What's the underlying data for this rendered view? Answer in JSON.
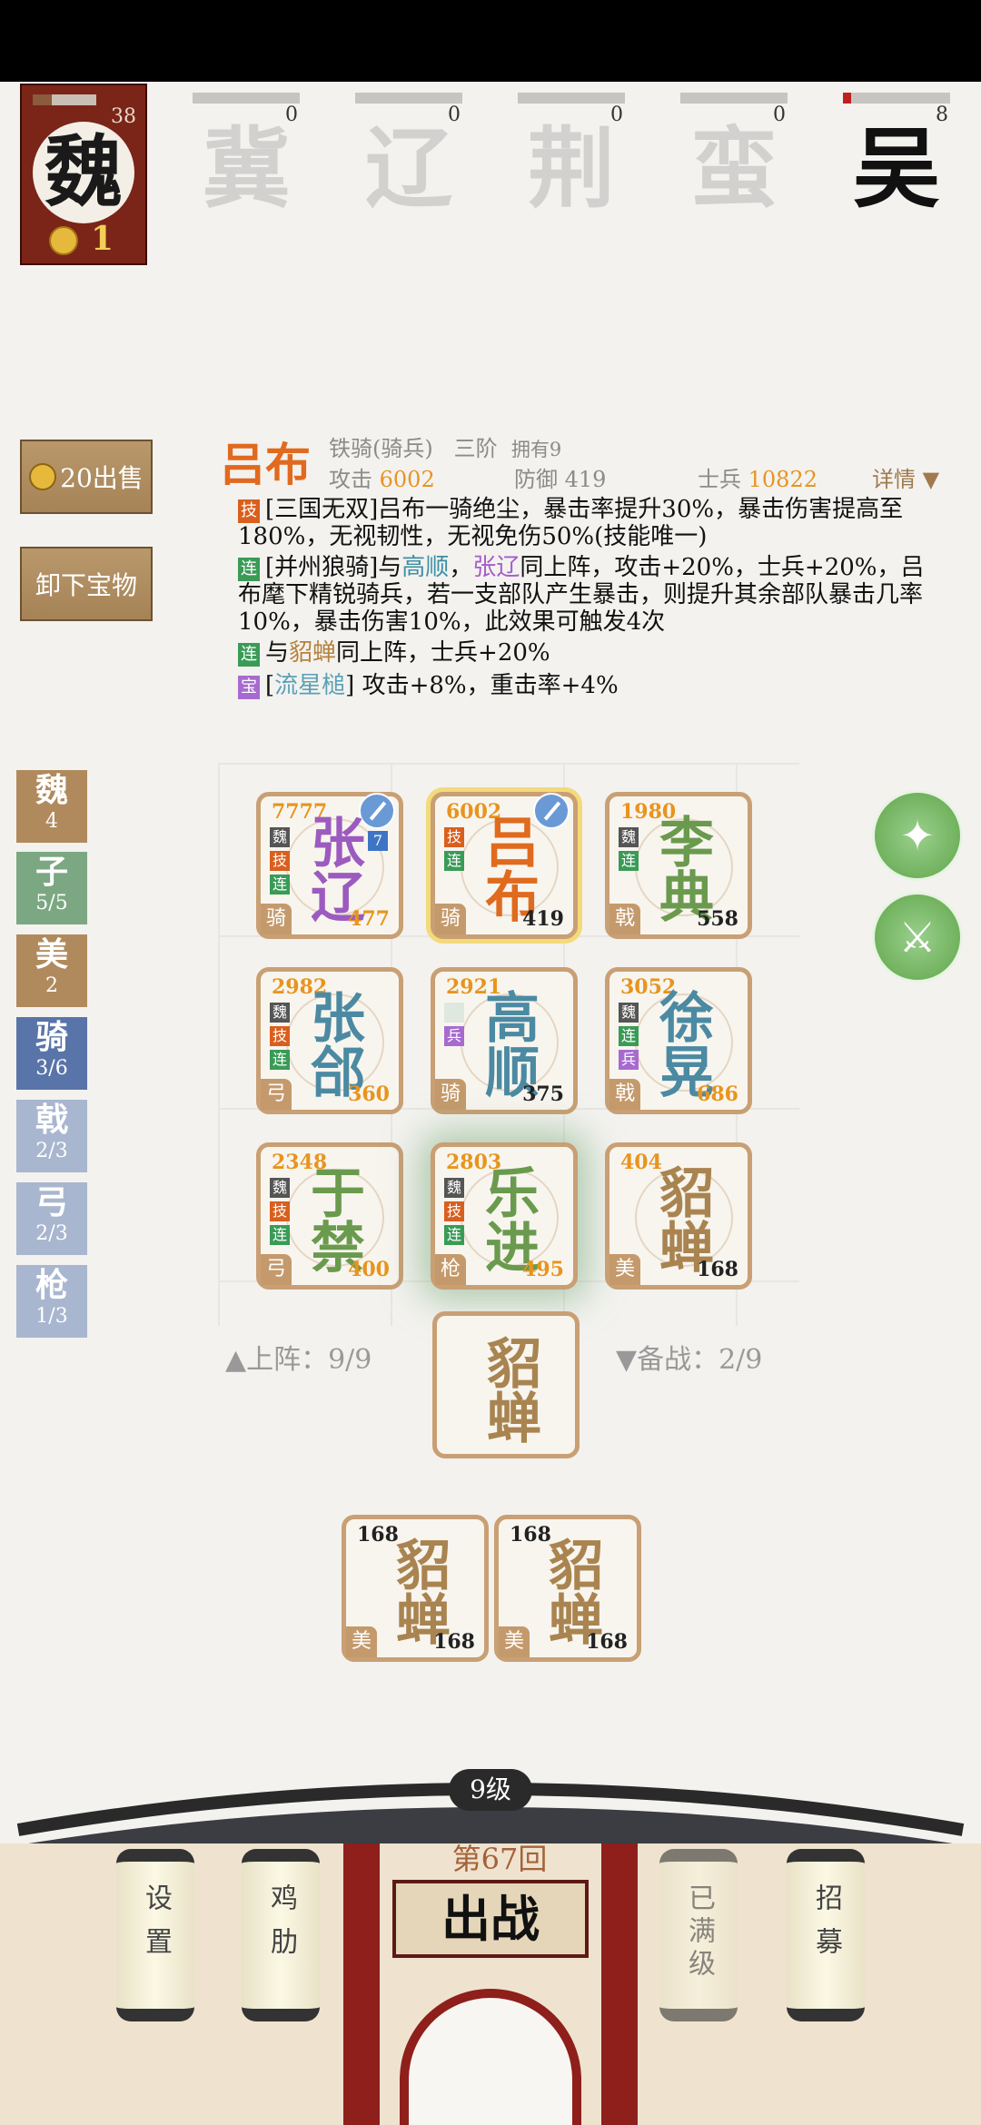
{
  "header": {
    "my_kingdom": {
      "name": "魏",
      "count": "38",
      "coins": "1",
      "bar_fill": 0.3
    },
    "states": [
      {
        "name": "冀",
        "count": "0",
        "bar_fill": 0
      },
      {
        "name": "辽",
        "count": "0",
        "bar_fill": 0
      },
      {
        "name": "荆",
        "count": "0",
        "bar_fill": 0
      },
      {
        "name": "蛮",
        "count": "0",
        "bar_fill": 0
      },
      {
        "name": "吴",
        "count": "8",
        "bar_fill": 0.08
      }
    ]
  },
  "buttons": {
    "sell": "20出售",
    "unequip": "卸下宝物",
    "details": "详情"
  },
  "hero": {
    "name": "吕布",
    "type": "铁骑(骑兵)",
    "rank": "三阶",
    "owned": "拥有9",
    "attack_label": "攻击",
    "attack": "6002",
    "defense_label": "防御",
    "defense": "419",
    "troops_label": "士兵",
    "troops": "10822"
  },
  "skills": [
    {
      "tag": "技",
      "text": "[三国无双]吕布一骑绝尘，暴击率提升30%，暴击伤害提高至180%，无视韧性，无视免伤50%(技能唯一)"
    },
    {
      "tag": "连",
      "pre": "[并州狼骑]与",
      "n1": "高顺",
      "sep": "，",
      "n2": "张辽",
      "post": "同上阵，攻击+20%，士兵+20%，吕布麾下精锐骑兵，若一支部队产生暴击，则提升其余部队暴击几率10%，暴击伤害10%，此效果可触发4次"
    },
    {
      "tag": "连",
      "pre": "与",
      "n1": "貂蝉",
      "post": "同上阵，士兵+20%"
    },
    {
      "tag": "宝",
      "pre": "[",
      "n1": "流星槌",
      "post": "] 攻击+8%，重击率+4%"
    }
  ],
  "filters": [
    {
      "label": "魏",
      "count": "4"
    },
    {
      "label": "子",
      "count": "5/5"
    },
    {
      "label": "美",
      "count": "2"
    },
    {
      "label": "骑",
      "count": "3/6"
    },
    {
      "label": "戟",
      "count": "2/3"
    },
    {
      "label": "弓",
      "count": "2/3"
    },
    {
      "label": "枪",
      "count": "1/3"
    }
  ],
  "grid_cards": [
    {
      "name1": "张",
      "name2": "辽",
      "atk": "7777",
      "hp": "477",
      "type": "骑",
      "tags": [
        "魏",
        "技",
        "连"
      ],
      "lvl": "7"
    },
    {
      "name1": "吕",
      "name2": "布",
      "atk": "6002",
      "hp": "419",
      "type": "骑",
      "tags": [
        "技",
        "连"
      ]
    },
    {
      "name1": "李",
      "name2": "典",
      "atk": "1980",
      "hp": "558",
      "type": "戟",
      "tags": [
        "魏",
        "连"
      ]
    },
    {
      "name1": "张",
      "name2": "郃",
      "atk": "2982",
      "hp": "360",
      "type": "弓",
      "tags": [
        "魏",
        "技",
        "连"
      ]
    },
    {
      "name1": "高",
      "name2": "顺",
      "atk": "2921",
      "hp": "375",
      "type": "骑",
      "tags": [
        "",
        "兵"
      ]
    },
    {
      "name1": "徐",
      "name2": "晃",
      "atk": "3052",
      "hp": "686",
      "type": "戟",
      "tags": [
        "魏",
        "连",
        "兵"
      ]
    },
    {
      "name1": "于",
      "name2": "禁",
      "atk": "2348",
      "hp": "400",
      "type": "弓",
      "tags": [
        "魏",
        "技",
        "连"
      ]
    },
    {
      "name1": "乐",
      "name2": "进",
      "atk": "2803",
      "hp": "495",
      "type": "枪",
      "tags": [
        "魏",
        "技",
        "连"
      ]
    },
    {
      "name1": "貂",
      "name2": "蝉",
      "atk": "404",
      "hp": "168",
      "type": "美",
      "tags": []
    }
  ],
  "deploy": {
    "on_label": "上阵：9/9",
    "reserve_label": "备战：2/9"
  },
  "center_card": {
    "name1": "貂",
    "name2": "蝉"
  },
  "reserve_cards": [
    {
      "name1": "貂",
      "name2": "蝉",
      "atk": "168",
      "hp": "168",
      "type": "美"
    },
    {
      "name1": "貂",
      "name2": "蝉",
      "atk": "168",
      "hp": "168",
      "type": "美"
    }
  ],
  "bottom": {
    "level": "9级",
    "round": "第67回",
    "battle": "出战",
    "lanterns": [
      "设置",
      "鸡肋",
      "已满级",
      "招募"
    ]
  }
}
